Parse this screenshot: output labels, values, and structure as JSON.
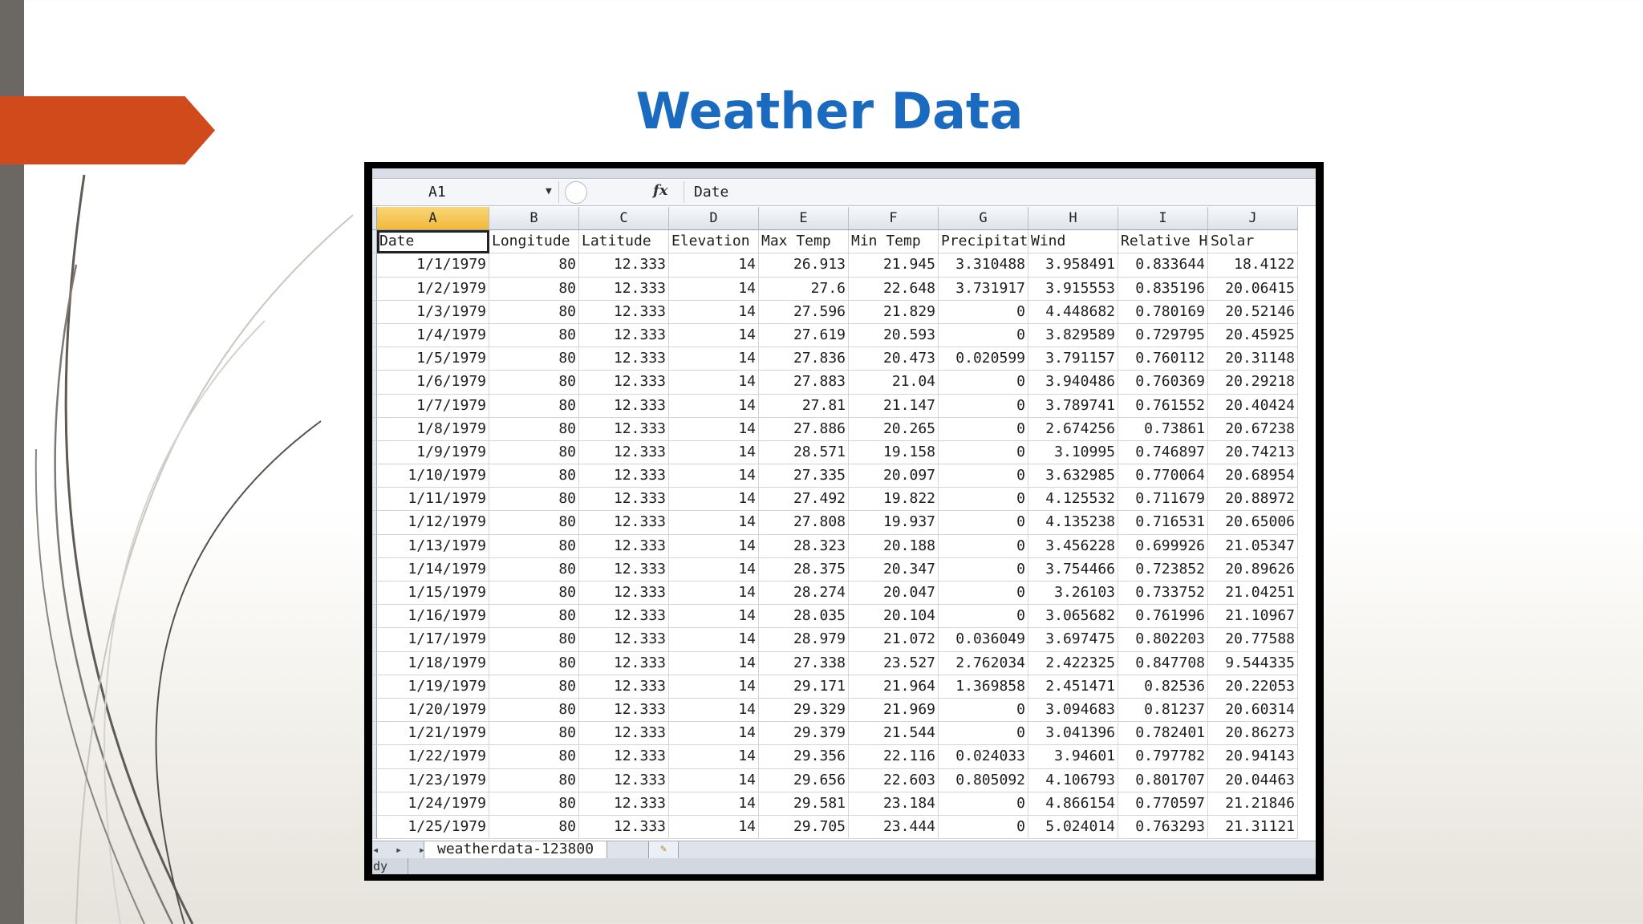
{
  "slide": {
    "title": "Weather Data",
    "colors": {
      "title": "#1a6bbf",
      "accent_arrow": "#d04a1c",
      "left_bar": "#6b6762"
    }
  },
  "excel": {
    "name_box": "A1",
    "formula_content": "Date",
    "fx_label": "fx",
    "column_letters": [
      "A",
      "B",
      "C",
      "D",
      "E",
      "F",
      "G",
      "H",
      "I",
      "J"
    ],
    "selected_column": "A",
    "headers": [
      "Date",
      "Longitude",
      "Latitude",
      "Elevation",
      "Max Temp",
      "Min Temp",
      "Precipitat",
      "Wind",
      "Relative H",
      "Solar"
    ],
    "rows": [
      [
        "1/1/1979",
        "80",
        "12.333",
        "14",
        "26.913",
        "21.945",
        "3.310488",
        "3.958491",
        "0.833644",
        "18.4122"
      ],
      [
        "1/2/1979",
        "80",
        "12.333",
        "14",
        "27.6",
        "22.648",
        "3.731917",
        "3.915553",
        "0.835196",
        "20.06415"
      ],
      [
        "1/3/1979",
        "80",
        "12.333",
        "14",
        "27.596",
        "21.829",
        "0",
        "4.448682",
        "0.780169",
        "20.52146"
      ],
      [
        "1/4/1979",
        "80",
        "12.333",
        "14",
        "27.619",
        "20.593",
        "0",
        "3.829589",
        "0.729795",
        "20.45925"
      ],
      [
        "1/5/1979",
        "80",
        "12.333",
        "14",
        "27.836",
        "20.473",
        "0.020599",
        "3.791157",
        "0.760112",
        "20.31148"
      ],
      [
        "1/6/1979",
        "80",
        "12.333",
        "14",
        "27.883",
        "21.04",
        "0",
        "3.940486",
        "0.760369",
        "20.29218"
      ],
      [
        "1/7/1979",
        "80",
        "12.333",
        "14",
        "27.81",
        "21.147",
        "0",
        "3.789741",
        "0.761552",
        "20.40424"
      ],
      [
        "1/8/1979",
        "80",
        "12.333",
        "14",
        "27.886",
        "20.265",
        "0",
        "2.674256",
        "0.73861",
        "20.67238"
      ],
      [
        "1/9/1979",
        "80",
        "12.333",
        "14",
        "28.571",
        "19.158",
        "0",
        "3.10995",
        "0.746897",
        "20.74213"
      ],
      [
        "1/10/1979",
        "80",
        "12.333",
        "14",
        "27.335",
        "20.097",
        "0",
        "3.632985",
        "0.770064",
        "20.68954"
      ],
      [
        "1/11/1979",
        "80",
        "12.333",
        "14",
        "27.492",
        "19.822",
        "0",
        "4.125532",
        "0.711679",
        "20.88972"
      ],
      [
        "1/12/1979",
        "80",
        "12.333",
        "14",
        "27.808",
        "19.937",
        "0",
        "4.135238",
        "0.716531",
        "20.65006"
      ],
      [
        "1/13/1979",
        "80",
        "12.333",
        "14",
        "28.323",
        "20.188",
        "0",
        "3.456228",
        "0.699926",
        "21.05347"
      ],
      [
        "1/14/1979",
        "80",
        "12.333",
        "14",
        "28.375",
        "20.347",
        "0",
        "3.754466",
        "0.723852",
        "20.89626"
      ],
      [
        "1/15/1979",
        "80",
        "12.333",
        "14",
        "28.274",
        "20.047",
        "0",
        "3.26103",
        "0.733752",
        "21.04251"
      ],
      [
        "1/16/1979",
        "80",
        "12.333",
        "14",
        "28.035",
        "20.104",
        "0",
        "3.065682",
        "0.761996",
        "21.10967"
      ],
      [
        "1/17/1979",
        "80",
        "12.333",
        "14",
        "28.979",
        "21.072",
        "0.036049",
        "3.697475",
        "0.802203",
        "20.77588"
      ],
      [
        "1/18/1979",
        "80",
        "12.333",
        "14",
        "27.338",
        "23.527",
        "2.762034",
        "2.422325",
        "0.847708",
        "9.544335"
      ],
      [
        "1/19/1979",
        "80",
        "12.333",
        "14",
        "29.171",
        "21.964",
        "1.369858",
        "2.451471",
        "0.82536",
        "20.22053"
      ],
      [
        "1/20/1979",
        "80",
        "12.333",
        "14",
        "29.329",
        "21.969",
        "0",
        "3.094683",
        "0.81237",
        "20.60314"
      ],
      [
        "1/21/1979",
        "80",
        "12.333",
        "14",
        "29.379",
        "21.544",
        "0",
        "3.041396",
        "0.782401",
        "20.86273"
      ],
      [
        "1/22/1979",
        "80",
        "12.333",
        "14",
        "29.356",
        "22.116",
        "0.024033",
        "3.94601",
        "0.797782",
        "20.94143"
      ],
      [
        "1/23/1979",
        "80",
        "12.333",
        "14",
        "29.656",
        "22.603",
        "0.805092",
        "4.106793",
        "0.801707",
        "20.04463"
      ],
      [
        "1/24/1979",
        "80",
        "12.333",
        "14",
        "29.581",
        "23.184",
        "0",
        "4.866154",
        "0.770597",
        "21.21846"
      ],
      [
        "1/25/1979",
        "80",
        "12.333",
        "14",
        "29.705",
        "23.444",
        "0",
        "5.024014",
        "0.763293",
        "21.31121"
      ]
    ],
    "sheet_tab": "weatherdata-123800",
    "tab_nav": "◂ ▸ ▸|",
    "new_sheet_icon": "✎",
    "status": "ady"
  }
}
